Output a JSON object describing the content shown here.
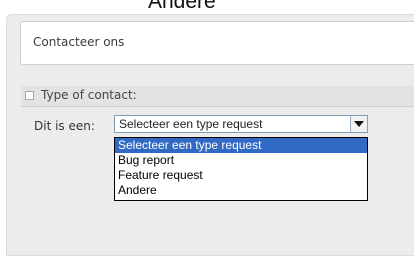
{
  "heading_partial": "Andere",
  "form": {
    "title": "Contacteer ons",
    "section_label": "Type of contact:",
    "row_label": "Dit is een:",
    "select": {
      "value": "Selecteer een type request",
      "options": [
        "Selecteer een type request",
        "Bug report",
        "Feature request",
        "Andere"
      ]
    }
  },
  "colors": {
    "selected_bg": "#316ac5",
    "select_border": "#7f9db9"
  },
  "icons": {
    "section_checkbox": "checkbox-icon",
    "select_arrow": "chevron-down-icon"
  }
}
